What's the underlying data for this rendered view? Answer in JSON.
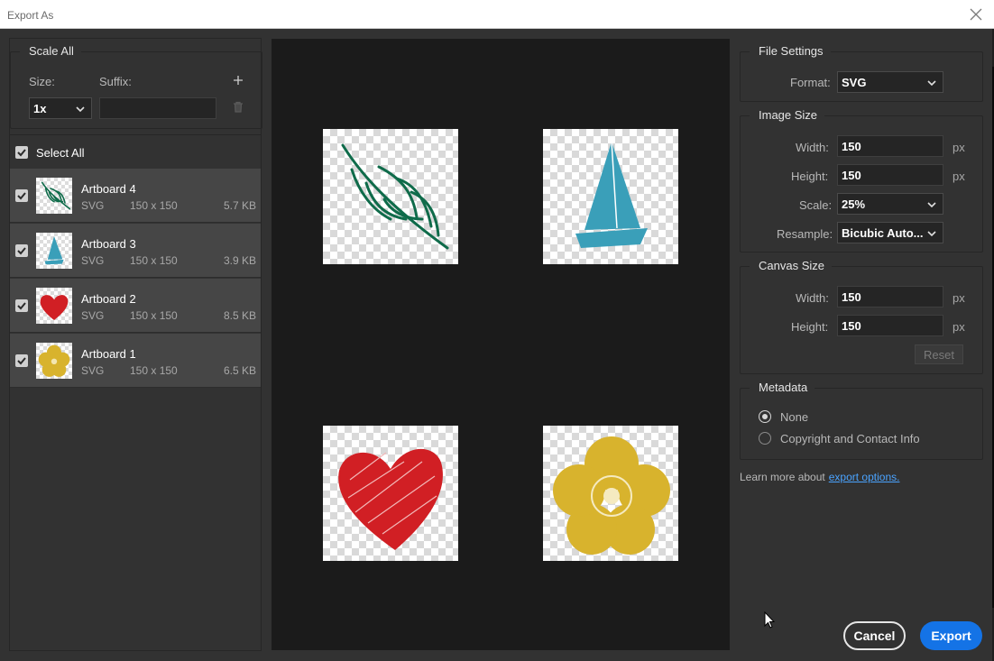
{
  "window": {
    "title": "Export As"
  },
  "scale_all": {
    "legend": "Scale All",
    "size_label": "Size:",
    "suffix_label": "Suffix:",
    "size_value": "1x",
    "suffix_value": ""
  },
  "select_all": {
    "label": "Select All",
    "checked": true
  },
  "artboards": [
    {
      "name": "Artboard 4",
      "format": "SVG",
      "dims": "150 x 150",
      "size": "5.7 KB",
      "icon": "leaf-icon"
    },
    {
      "name": "Artboard 3",
      "format": "SVG",
      "dims": "150 x 150",
      "size": "3.9 KB",
      "icon": "sailboat-icon"
    },
    {
      "name": "Artboard 2",
      "format": "SVG",
      "dims": "150 x 150",
      "size": "8.5 KB",
      "icon": "heart-icon"
    },
    {
      "name": "Artboard 1",
      "format": "SVG",
      "dims": "150 x 150",
      "size": "6.5 KB",
      "icon": "flower-icon"
    }
  ],
  "file_settings": {
    "legend": "File Settings",
    "format_label": "Format:",
    "format_value": "SVG"
  },
  "image_size": {
    "legend": "Image Size",
    "width_label": "Width:",
    "width_value": "150",
    "height_label": "Height:",
    "height_value": "150",
    "scale_label": "Scale:",
    "scale_value": "25%",
    "resample_label": "Resample:",
    "resample_value": "Bicubic Auto...",
    "unit": "px"
  },
  "canvas_size": {
    "legend": "Canvas Size",
    "width_label": "Width:",
    "width_value": "150",
    "height_label": "Height:",
    "height_value": "150",
    "unit": "px",
    "reset_label": "Reset"
  },
  "metadata": {
    "legend": "Metadata",
    "options": [
      "None",
      "Copyright and Contact Info"
    ],
    "selected": "None"
  },
  "learn_more": {
    "text": "Learn more about",
    "link": "export options."
  },
  "buttons": {
    "cancel": "Cancel",
    "export": "Export"
  },
  "colors": {
    "leaf": "#0f6b4a",
    "sailboat": "#3a9fb9",
    "heart": "#d11f24",
    "flower": "#d8b32d",
    "accent": "#1473e6"
  }
}
